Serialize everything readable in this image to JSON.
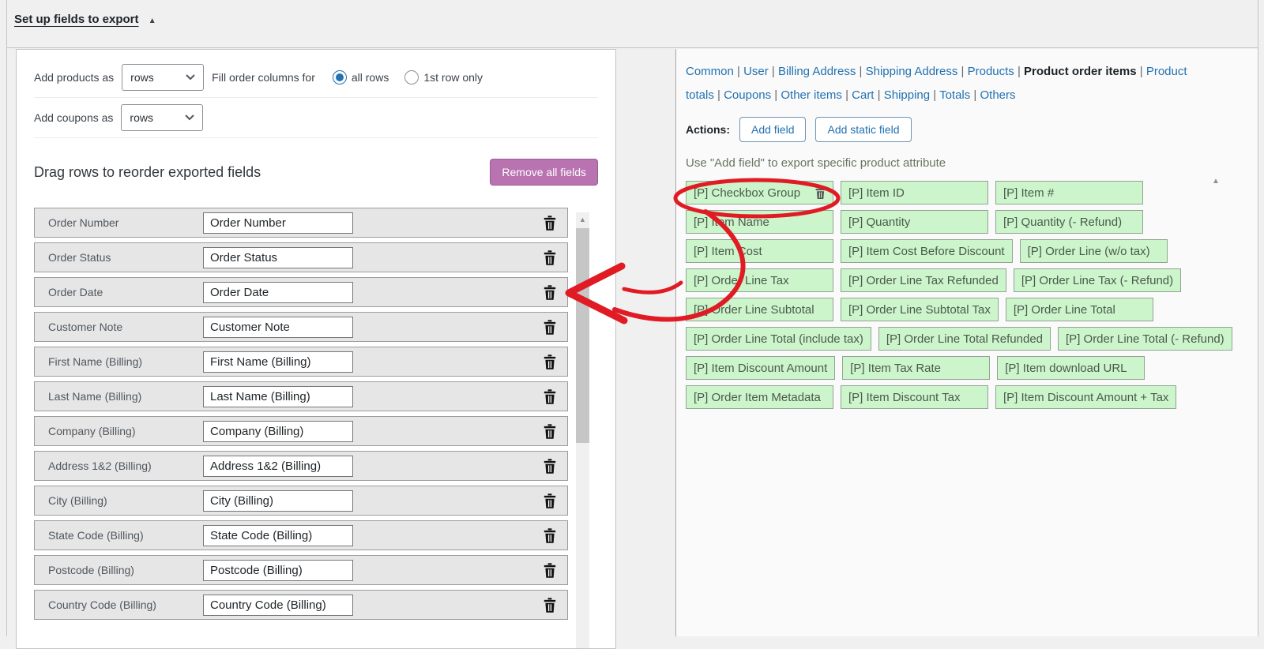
{
  "header": {
    "title": "Set up fields to export",
    "collapse_icon": "▲"
  },
  "left_panel": {
    "add_products_label": "Add products as",
    "add_products_value": "rows",
    "fill_columns_label": "Fill order columns for",
    "radio_all_rows_label": "all rows",
    "radio_first_row_label": "1st row only",
    "add_coupons_label": "Add coupons as",
    "add_coupons_value": "rows",
    "reorder_heading": "Drag rows to reorder exported fields",
    "remove_all_button": "Remove all fields",
    "fields": [
      {
        "label": "Order Number",
        "value": "Order Number"
      },
      {
        "label": "Order Status",
        "value": "Order Status"
      },
      {
        "label": "Order Date",
        "value": "Order Date"
      },
      {
        "label": "Customer Note",
        "value": "Customer Note"
      },
      {
        "label": "First Name (Billing)",
        "value": "First Name (Billing)"
      },
      {
        "label": "Last Name (Billing)",
        "value": "Last Name (Billing)"
      },
      {
        "label": "Company (Billing)",
        "value": "Company (Billing)"
      },
      {
        "label": "Address 1&2 (Billing)",
        "value": "Address 1&2 (Billing)"
      },
      {
        "label": "City (Billing)",
        "value": "City (Billing)"
      },
      {
        "label": "State Code (Billing)",
        "value": "State Code (Billing)"
      },
      {
        "label": "Postcode (Billing)",
        "value": "Postcode (Billing)"
      },
      {
        "label": "Country Code (Billing)",
        "value": "Country Code (Billing)"
      }
    ]
  },
  "right_panel": {
    "nav_tabs": [
      {
        "label": "Common",
        "active": false
      },
      {
        "label": "User",
        "active": false
      },
      {
        "label": "Billing Address",
        "active": false
      },
      {
        "label": "Shipping Address",
        "active": false
      },
      {
        "label": "Products",
        "active": false
      },
      {
        "label": "Product order items",
        "active": true
      },
      {
        "label": "Product totals",
        "active": false
      },
      {
        "label": "Coupons",
        "active": false
      },
      {
        "label": "Other items",
        "active": false
      },
      {
        "label": "Cart",
        "active": false
      },
      {
        "label": "Shipping",
        "active": false
      },
      {
        "label": "Totals",
        "active": false
      },
      {
        "label": "Others",
        "active": false
      }
    ],
    "actions_label": "Actions:",
    "add_field_button": "Add field",
    "add_static_field_button": "Add static field",
    "hint": "Use \"Add field\" to export specific product attribute",
    "field_button_rows": [
      [
        {
          "label": "[P] Checkbox Group",
          "has_trash": true,
          "circled": true
        },
        {
          "label": "[P] Item ID"
        },
        {
          "label": "[P] Item #"
        }
      ],
      [
        {
          "label": "[P] Item Name"
        },
        {
          "label": "[P] Quantity"
        },
        {
          "label": "[P] Quantity (- Refund)"
        }
      ],
      [
        {
          "label": "[P] Item Cost"
        },
        {
          "label": "[P] Item Cost Before Discount"
        },
        {
          "label": "[P] Order Line (w/o tax)"
        }
      ],
      [
        {
          "label": "[P] Order Line Tax"
        },
        {
          "label": "[P] Order Line Tax Refunded"
        },
        {
          "label": "[P] Order Line Tax (- Refund)"
        }
      ],
      [
        {
          "label": "[P] Order Line Subtotal"
        },
        {
          "label": "[P] Order Line Subtotal Tax"
        },
        {
          "label": "[P] Order Line Total"
        }
      ],
      [
        {
          "label": "[P] Order Line Total (include tax)"
        },
        {
          "label": "[P] Order Line Total Refunded"
        },
        {
          "label": "[P] Order Line Total (- Refund)"
        }
      ],
      [
        {
          "label": "[P] Item Discount Amount"
        },
        {
          "label": "[P] Item Tax Rate"
        },
        {
          "label": "[P] Item download URL"
        }
      ],
      [
        {
          "label": "[P] Order Item Metadata"
        },
        {
          "label": "[P] Item Discount Tax"
        },
        {
          "label": "[P] Item Discount Amount + Tax"
        }
      ]
    ]
  },
  "colors": {
    "accent_blue": "#2271b1",
    "remove_button_purple": "#b873b0",
    "field_button_green": "#ccf5cc",
    "annotation_red": "#e01b24"
  }
}
